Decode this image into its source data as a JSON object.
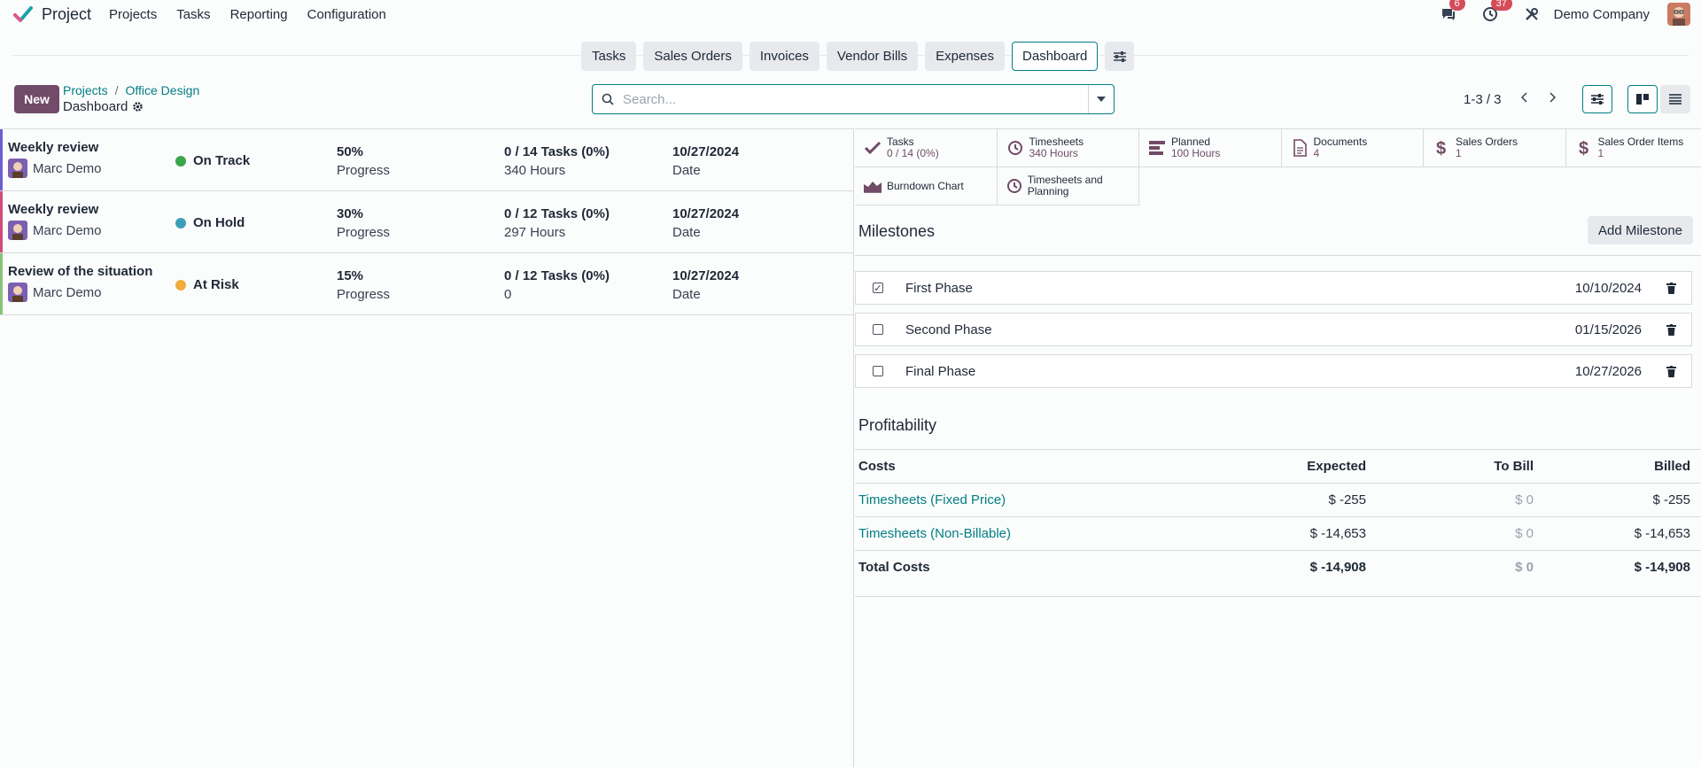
{
  "navbar": {
    "app_name": "Project",
    "menu": [
      "Projects",
      "Tasks",
      "Reporting",
      "Configuration"
    ],
    "messages_count": "6",
    "activities_count": "37",
    "company": "Demo Company"
  },
  "actions": {
    "buttons": [
      "Tasks",
      "Sales Orders",
      "Invoices",
      "Vendor Bills",
      "Expenses",
      "Dashboard"
    ],
    "active": "Dashboard"
  },
  "control": {
    "new_label": "New",
    "breadcrumb": [
      "Projects",
      "Office Design"
    ],
    "title": "Dashboard",
    "search_placeholder": "Search...",
    "pager": "1-3 / 3"
  },
  "updates": [
    {
      "name": "Weekly review",
      "user": "Marc Demo",
      "status": "On Track",
      "status_color": "#3aa64a",
      "bar_color": "#6c5fd1",
      "progress": "50%",
      "progress_label": "Progress",
      "tasks": "0 / 14 Tasks (0%)",
      "hours": "340 Hours",
      "date": "10/27/2024",
      "date_label": "Date"
    },
    {
      "name": "Weekly review",
      "user": "Marc Demo",
      "status": "On Hold",
      "status_color": "#3b9fb8",
      "bar_color": "#d14a7a",
      "progress": "30%",
      "progress_label": "Progress",
      "tasks": "0 / 12 Tasks (0%)",
      "hours": "297 Hours",
      "date": "10/27/2024",
      "date_label": "Date"
    },
    {
      "name": "Review of the situation",
      "user": "Marc Demo",
      "status": "At Risk",
      "status_color": "#f0ad3a",
      "bar_color": "#8bc27a",
      "progress": "15%",
      "progress_label": "Progress",
      "tasks": "0 / 12 Tasks (0%)",
      "hours": "0",
      "date": "10/27/2024",
      "date_label": "Date"
    }
  ],
  "stats": [
    {
      "label": "Tasks",
      "value": "0 / 14 (0%)",
      "icon": "check-icon"
    },
    {
      "label": "Timesheets",
      "value": "340 Hours",
      "icon": "clock-icon"
    },
    {
      "label": "Planned",
      "value": "100 Hours",
      "icon": "planning-icon"
    },
    {
      "label": "Documents",
      "value": "4",
      "icon": "document-icon"
    },
    {
      "label": "Sales Orders",
      "value": "1",
      "icon": "dollar-icon"
    },
    {
      "label": "Sales Order Items",
      "value": "1",
      "icon": "dollar-icon"
    },
    {
      "label": "Burndown Chart",
      "value": "",
      "icon": "area-chart-icon"
    },
    {
      "label": "Timesheets and Planning",
      "value": "",
      "icon": "clock-icon"
    }
  ],
  "milestones": {
    "title": "Milestones",
    "add_label": "Add Milestone",
    "items": [
      {
        "name": "First Phase",
        "date": "10/10/2024",
        "done": true
      },
      {
        "name": "Second Phase",
        "date": "01/15/2026",
        "done": false
      },
      {
        "name": "Final Phase",
        "date": "10/27/2026",
        "done": false
      }
    ]
  },
  "profitability": {
    "title": "Profitability",
    "headers": [
      "Costs",
      "Expected",
      "To Bill",
      "Billed"
    ],
    "rows": [
      {
        "label": "Timesheets (Fixed Price)",
        "expected": "$ -255",
        "to_bill": "$ 0",
        "billed": "$ -255"
      },
      {
        "label": "Timesheets (Non-Billable)",
        "expected": "$ -14,653",
        "to_bill": "$ 0",
        "billed": "$ -14,653"
      }
    ],
    "total": {
      "label": "Total Costs",
      "expected": "$ -14,908",
      "to_bill": "$ 0",
      "billed": "$ -14,908"
    }
  },
  "colors": {
    "brand": "#714b67",
    "accent": "#017e84"
  }
}
